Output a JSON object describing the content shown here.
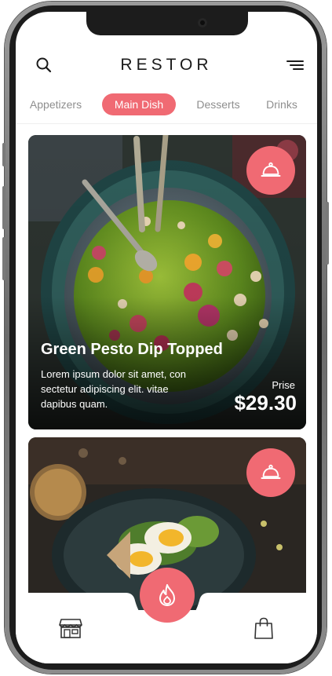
{
  "app": {
    "brand": "RESTOR"
  },
  "header": {
    "search_icon": "search-icon",
    "menu_icon": "menu-icon"
  },
  "tabs": [
    {
      "label": "Appetizers",
      "active": false
    },
    {
      "label": "Main Dish",
      "active": true
    },
    {
      "label": "Desserts",
      "active": false
    },
    {
      "label": "Drinks",
      "active": false
    }
  ],
  "cards": [
    {
      "title": "Green Pesto Dip Topped",
      "description": "Lorem ipsum dolor sit amet, con sectetur adipiscing elit. vitae dapibus quam.",
      "price_label": "Prise",
      "price": "$29.30",
      "action_icon": "cloche-icon"
    },
    {
      "action_icon": "cloche-icon"
    }
  ],
  "bottom_nav": {
    "left_icon": "store-icon",
    "center_icon": "flame-icon",
    "right_icon": "shopping-bag-icon"
  },
  "colors": {
    "accent": "#f06a73",
    "text_dark": "#1a1a1a",
    "tab_inactive": "#8e8e8e",
    "background": "#ffffff"
  }
}
